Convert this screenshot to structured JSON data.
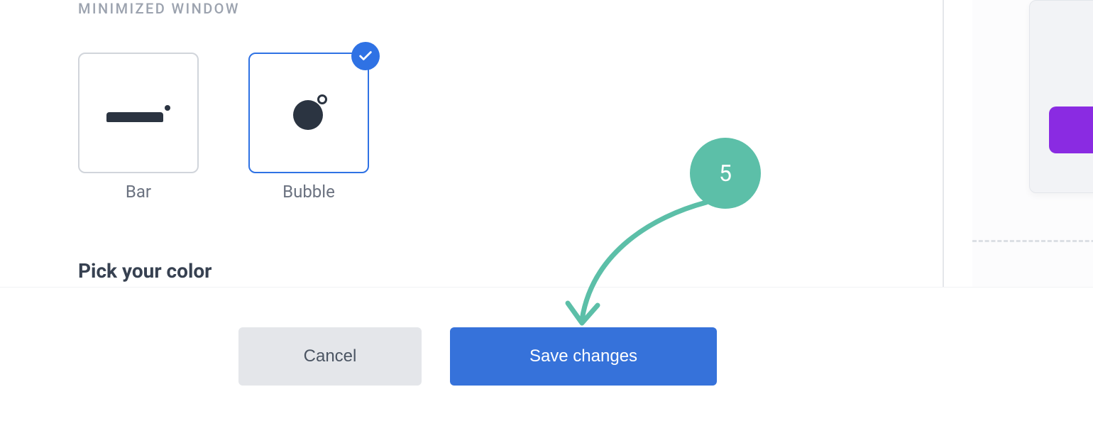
{
  "section": {
    "label": "MINIMIZED WINDOW",
    "options": {
      "bar": "Bar",
      "bubble": "Bubble"
    },
    "selected": "bubble",
    "heading": "Pick your color"
  },
  "footer": {
    "cancel_label": "Cancel",
    "save_label": "Save changes"
  },
  "callout": {
    "step": "5"
  },
  "colors": {
    "accent_purple": "#8a2be2",
    "primary_blue": "#3672da",
    "teal": "#5cbfa8"
  }
}
